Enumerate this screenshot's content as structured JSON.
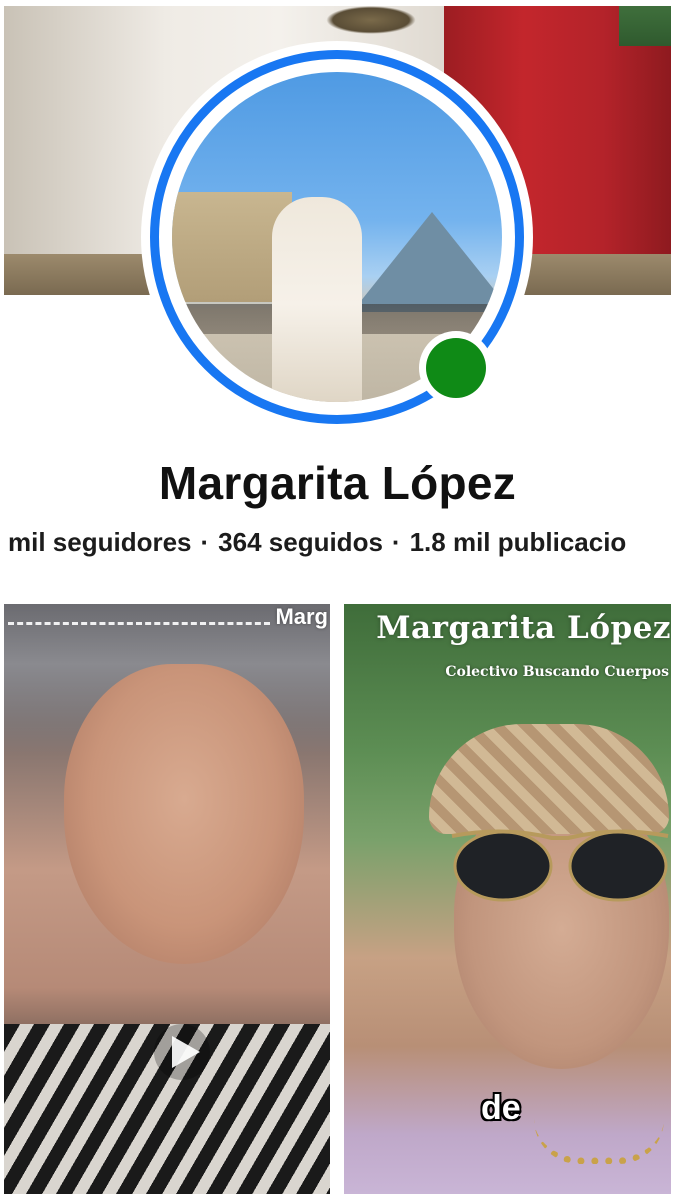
{
  "profile": {
    "name": "Margarita López",
    "stats": {
      "followers": "mil seguidores",
      "following": "364 seguidos",
      "posts": "1.8 mil publicacio",
      "separator": "·"
    },
    "online": true
  },
  "reels": [
    {
      "overlay_text": "Marg",
      "play_icon": "play-icon"
    },
    {
      "overlay_title": "Margarita López",
      "overlay_subtitle": "Colectivo Buscando Cuerpos",
      "caption": "de"
    }
  ],
  "colors": {
    "avatar_ring": "#1877f2",
    "online_dot": "#0f8a16",
    "text": "#111111"
  }
}
